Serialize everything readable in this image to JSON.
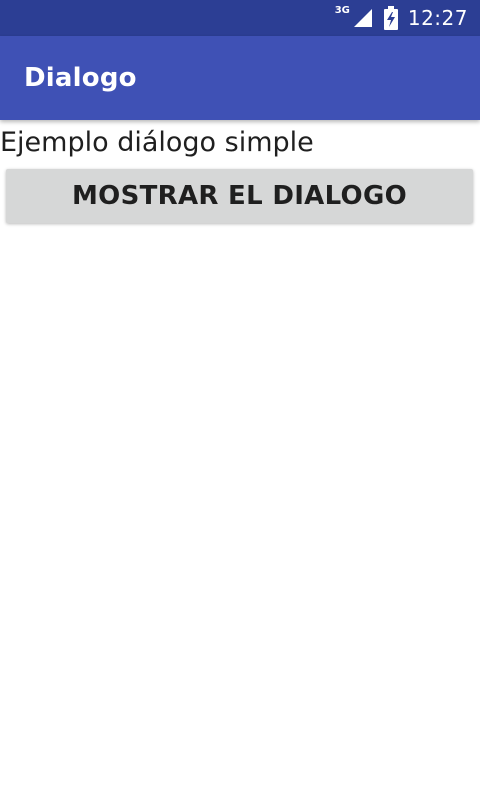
{
  "status_bar": {
    "network_type": "3G",
    "time": "12:27",
    "icons": [
      "signal-icon",
      "battery-charging-icon"
    ],
    "colors": {
      "background": "#2c3e94",
      "foreground": "#ffffff"
    }
  },
  "app_bar": {
    "title": "Dialogo",
    "colors": {
      "background": "#3f51b5",
      "title": "#ffffff"
    }
  },
  "content": {
    "label": "Ejemplo diálogo simple",
    "show_dialog_button_label": "MOSTRAR EL DIALOGO",
    "colors": {
      "button_background": "#d6d7d7",
      "text": "#1f1f1f"
    }
  }
}
